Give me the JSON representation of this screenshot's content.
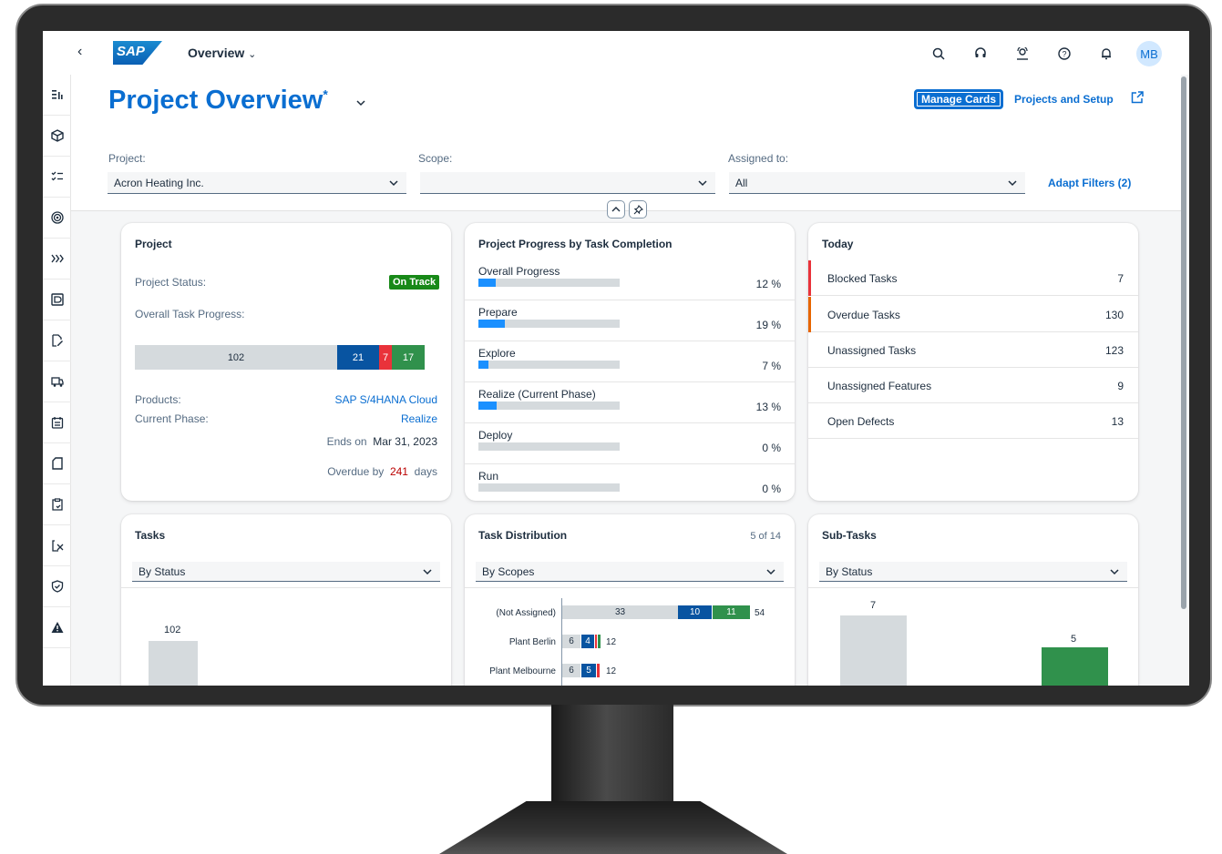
{
  "shell": {
    "logo_text": "SAP",
    "app_title": "Overview",
    "avatar_initials": "MB"
  },
  "header": {
    "title": "Project Overview",
    "title_marker": "*",
    "manage_cards": "Manage Cards",
    "projects_setup": "Projects and Setup"
  },
  "filters": {
    "project_label": "Project:",
    "project_value": "Acron Heating Inc.",
    "scope_label": "Scope:",
    "scope_value": "",
    "assigned_label": "Assigned to:",
    "assigned_value": "All",
    "adapt": "Adapt Filters (2)"
  },
  "project_card": {
    "title": "Project",
    "status_label": "Project Status:",
    "status_value": "On Track",
    "progress_label": "Overall Task Progress:",
    "progress_segments": [
      {
        "value": "102",
        "color": "#d5dadd"
      },
      {
        "value": "21",
        "color": "#0854a1"
      },
      {
        "value": "7",
        "color": "#e9323a"
      },
      {
        "value": "17",
        "color": "#30914c"
      }
    ],
    "products_label": "Products:",
    "products_value": "SAP S/4HANA Cloud",
    "phase_label": "Current Phase:",
    "phase_value": "Realize",
    "ends_on_label": "Ends on",
    "ends_on_value": "Mar 31, 2023",
    "overdue_label": "Overdue by",
    "overdue_value": "241",
    "overdue_unit": "days"
  },
  "progress_card": {
    "title": "Project Progress by Task Completion",
    "rows": [
      {
        "label": "Overall Progress",
        "pct": "12 %",
        "fraction": 0.12
      },
      {
        "label": "Prepare",
        "pct": "19 %",
        "fraction": 0.19
      },
      {
        "label": "Explore",
        "pct": "7 %",
        "fraction": 0.07
      },
      {
        "label": "Realize (Current Phase)",
        "pct": "13 %",
        "fraction": 0.13
      },
      {
        "label": "Deploy",
        "pct": "0 %",
        "fraction": 0
      },
      {
        "label": "Run",
        "pct": "0 %",
        "fraction": 0
      }
    ]
  },
  "today_card": {
    "title": "Today",
    "rows": [
      {
        "label": "Blocked Tasks",
        "value": "7",
        "indicator": "#e9323a"
      },
      {
        "label": "Overdue Tasks",
        "value": "130",
        "indicator": "#e76500"
      },
      {
        "label": "Unassigned Tasks",
        "value": "123",
        "indicator": ""
      },
      {
        "label": "Unassigned Features",
        "value": "9",
        "indicator": ""
      },
      {
        "label": "Open Defects",
        "value": "13",
        "indicator": ""
      }
    ]
  },
  "tasks_card": {
    "title": "Tasks",
    "select": "By Status",
    "bar_value": "102"
  },
  "distribution_card": {
    "title": "Task Distribution",
    "count": "5 of 14",
    "select": "By Scopes",
    "rows": [
      {
        "label": "(Not Assigned)",
        "segments": [
          "33",
          "10",
          "11"
        ],
        "total": "54"
      },
      {
        "label": "Plant Berlin",
        "segments": [
          "6",
          "4",
          ""
        ],
        "total": "12"
      },
      {
        "label": "Plant Melbourne",
        "segments": [
          "6",
          "5",
          ""
        ],
        "total": "12"
      }
    ]
  },
  "subtasks_card": {
    "title": "Sub-Tasks",
    "select": "By Status",
    "bar1_value": "7",
    "bar2_value": "5"
  }
}
